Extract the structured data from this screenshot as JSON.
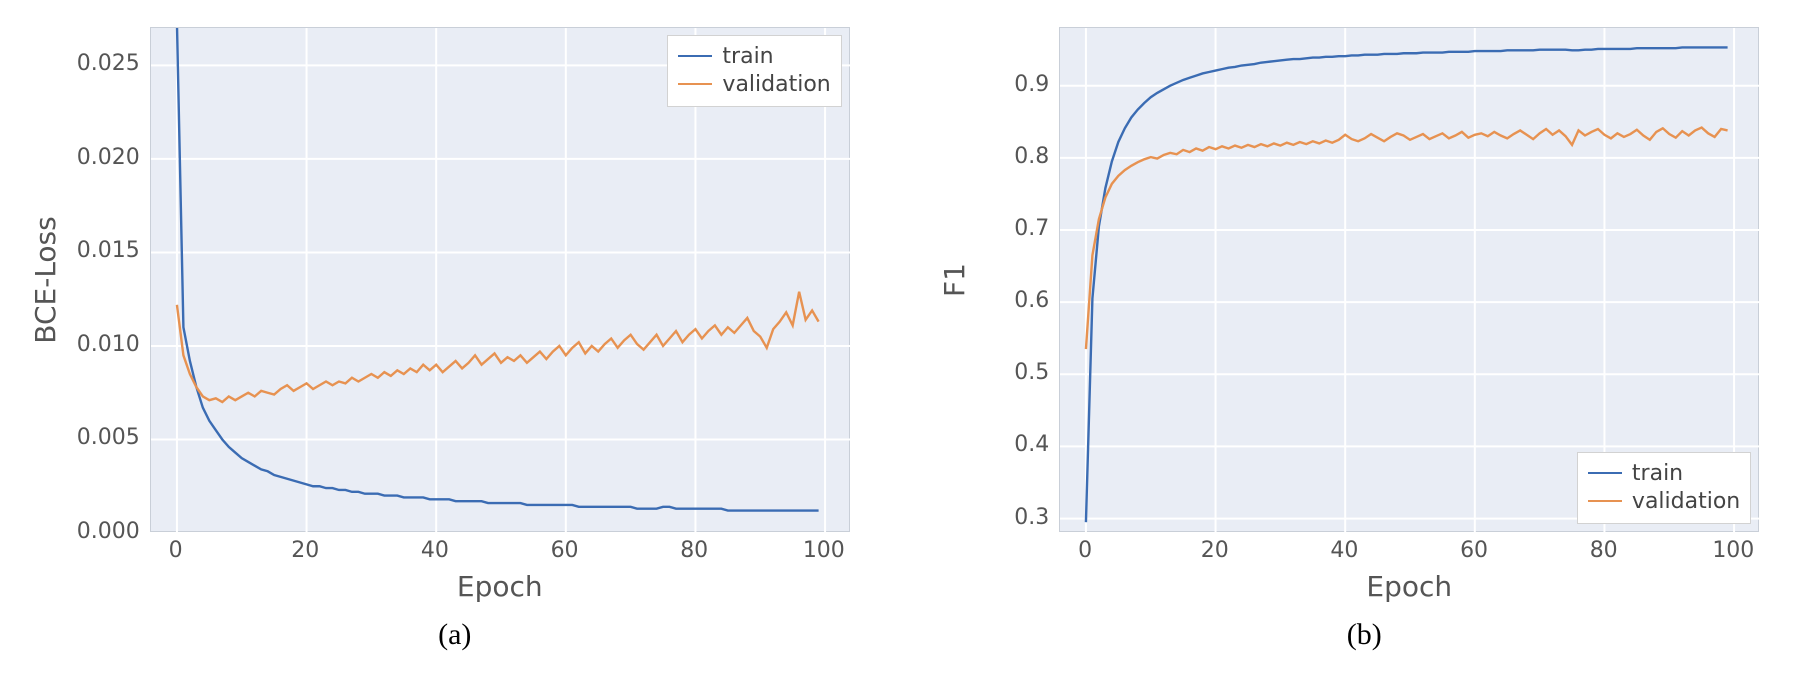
{
  "chart_data": [
    {
      "id": "a",
      "type": "line",
      "caption": "(a)",
      "xlabel": "Epoch",
      "ylabel": "BCE-Loss",
      "xlim": [
        -4,
        104
      ],
      "ylim": [
        0.0,
        0.027
      ],
      "xticks": [
        0,
        20,
        40,
        60,
        80,
        100
      ],
      "yticks": [
        0.0,
        0.005,
        0.01,
        0.015,
        0.02,
        0.025
      ],
      "ytick_labels": [
        "0.000",
        "0.005",
        "0.010",
        "0.015",
        "0.020",
        "0.025"
      ],
      "grid": true,
      "legend_pos": "top-right",
      "series": [
        {
          "name": "train",
          "color": "#3b6cb3",
          "values": [
            0.0273,
            0.011,
            0.0092,
            0.0078,
            0.0067,
            0.006,
            0.0055,
            0.005,
            0.0046,
            0.0043,
            0.004,
            0.0038,
            0.0036,
            0.0034,
            0.0033,
            0.0031,
            0.003,
            0.0029,
            0.0028,
            0.0027,
            0.0026,
            0.0025,
            0.0025,
            0.0024,
            0.0024,
            0.0023,
            0.0023,
            0.0022,
            0.0022,
            0.0021,
            0.0021,
            0.0021,
            0.002,
            0.002,
            0.002,
            0.0019,
            0.0019,
            0.0019,
            0.0019,
            0.0018,
            0.0018,
            0.0018,
            0.0018,
            0.0017,
            0.0017,
            0.0017,
            0.0017,
            0.0017,
            0.0016,
            0.0016,
            0.0016,
            0.0016,
            0.0016,
            0.0016,
            0.0015,
            0.0015,
            0.0015,
            0.0015,
            0.0015,
            0.0015,
            0.0015,
            0.0015,
            0.0014,
            0.0014,
            0.0014,
            0.0014,
            0.0014,
            0.0014,
            0.0014,
            0.0014,
            0.0014,
            0.0013,
            0.0013,
            0.0013,
            0.0013,
            0.0014,
            0.0014,
            0.0013,
            0.0013,
            0.0013,
            0.0013,
            0.0013,
            0.0013,
            0.0013,
            0.0013,
            0.0012,
            0.0012,
            0.0012,
            0.0012,
            0.0012,
            0.0012,
            0.0012,
            0.0012,
            0.0012,
            0.0012,
            0.0012,
            0.0012,
            0.0012,
            0.0012,
            0.0012
          ]
        },
        {
          "name": "validation",
          "color": "#e79251",
          "values": [
            0.0122,
            0.0095,
            0.0085,
            0.0078,
            0.0073,
            0.0071,
            0.0072,
            0.007,
            0.0073,
            0.0071,
            0.0073,
            0.0075,
            0.0073,
            0.0076,
            0.0075,
            0.0074,
            0.0077,
            0.0079,
            0.0076,
            0.0078,
            0.008,
            0.0077,
            0.0079,
            0.0081,
            0.0079,
            0.0081,
            0.008,
            0.0083,
            0.0081,
            0.0083,
            0.0085,
            0.0083,
            0.0086,
            0.0084,
            0.0087,
            0.0085,
            0.0088,
            0.0086,
            0.009,
            0.0087,
            0.009,
            0.0086,
            0.0089,
            0.0092,
            0.0088,
            0.0091,
            0.0095,
            0.009,
            0.0093,
            0.0096,
            0.0091,
            0.0094,
            0.0092,
            0.0095,
            0.0091,
            0.0094,
            0.0097,
            0.0093,
            0.0097,
            0.01,
            0.0095,
            0.0099,
            0.0102,
            0.0096,
            0.01,
            0.0097,
            0.0101,
            0.0104,
            0.0099,
            0.0103,
            0.0106,
            0.0101,
            0.0098,
            0.0102,
            0.0106,
            0.01,
            0.0104,
            0.0108,
            0.0102,
            0.0106,
            0.0109,
            0.0104,
            0.0108,
            0.0111,
            0.0106,
            0.011,
            0.0107,
            0.0111,
            0.0115,
            0.0108,
            0.0105,
            0.0099,
            0.0109,
            0.0113,
            0.0118,
            0.0111,
            0.0129,
            0.0114,
            0.0119,
            0.0113
          ]
        }
      ]
    },
    {
      "id": "b",
      "type": "line",
      "caption": "(b)",
      "xlabel": "Epoch",
      "ylabel": "F1",
      "xlim": [
        -4,
        104
      ],
      "ylim": [
        0.28,
        0.98
      ],
      "xticks": [
        0,
        20,
        40,
        60,
        80,
        100
      ],
      "yticks": [
        0.3,
        0.4,
        0.5,
        0.6,
        0.7,
        0.8,
        0.9
      ],
      "ytick_labels": [
        "0.3",
        "0.4",
        "0.5",
        "0.6",
        "0.7",
        "0.8",
        "0.9"
      ],
      "grid": true,
      "legend_pos": "bottom-right",
      "series": [
        {
          "name": "train",
          "color": "#3b6cb3",
          "values": [
            0.295,
            0.605,
            0.705,
            0.758,
            0.795,
            0.822,
            0.841,
            0.856,
            0.867,
            0.876,
            0.884,
            0.89,
            0.895,
            0.9,
            0.904,
            0.908,
            0.911,
            0.914,
            0.917,
            0.919,
            0.921,
            0.923,
            0.925,
            0.926,
            0.928,
            0.929,
            0.93,
            0.932,
            0.933,
            0.934,
            0.935,
            0.936,
            0.937,
            0.937,
            0.938,
            0.939,
            0.939,
            0.94,
            0.94,
            0.941,
            0.941,
            0.942,
            0.942,
            0.943,
            0.943,
            0.943,
            0.944,
            0.944,
            0.944,
            0.945,
            0.945,
            0.945,
            0.946,
            0.946,
            0.946,
            0.946,
            0.947,
            0.947,
            0.947,
            0.947,
            0.948,
            0.948,
            0.948,
            0.948,
            0.948,
            0.949,
            0.949,
            0.949,
            0.949,
            0.949,
            0.95,
            0.95,
            0.95,
            0.95,
            0.95,
            0.949,
            0.949,
            0.95,
            0.95,
            0.951,
            0.951,
            0.951,
            0.951,
            0.951,
            0.951,
            0.952,
            0.952,
            0.952,
            0.952,
            0.952,
            0.952,
            0.952,
            0.953,
            0.953,
            0.953,
            0.953,
            0.953,
            0.953,
            0.953,
            0.953
          ]
        },
        {
          "name": "validation",
          "color": "#e79251",
          "values": [
            0.535,
            0.665,
            0.715,
            0.745,
            0.764,
            0.775,
            0.783,
            0.789,
            0.794,
            0.798,
            0.801,
            0.799,
            0.804,
            0.807,
            0.805,
            0.811,
            0.808,
            0.813,
            0.81,
            0.815,
            0.812,
            0.816,
            0.813,
            0.817,
            0.814,
            0.818,
            0.815,
            0.819,
            0.816,
            0.82,
            0.817,
            0.821,
            0.818,
            0.822,
            0.819,
            0.823,
            0.82,
            0.824,
            0.821,
            0.825,
            0.832,
            0.826,
            0.823,
            0.827,
            0.833,
            0.828,
            0.823,
            0.829,
            0.834,
            0.831,
            0.825,
            0.829,
            0.833,
            0.826,
            0.83,
            0.834,
            0.827,
            0.831,
            0.836,
            0.828,
            0.832,
            0.834,
            0.83,
            0.836,
            0.831,
            0.827,
            0.833,
            0.838,
            0.832,
            0.826,
            0.834,
            0.84,
            0.832,
            0.838,
            0.83,
            0.818,
            0.838,
            0.831,
            0.836,
            0.84,
            0.832,
            0.827,
            0.834,
            0.829,
            0.833,
            0.839,
            0.831,
            0.825,
            0.836,
            0.841,
            0.833,
            0.828,
            0.837,
            0.831,
            0.838,
            0.842,
            0.834,
            0.829,
            0.84,
            0.838
          ]
        }
      ]
    }
  ]
}
